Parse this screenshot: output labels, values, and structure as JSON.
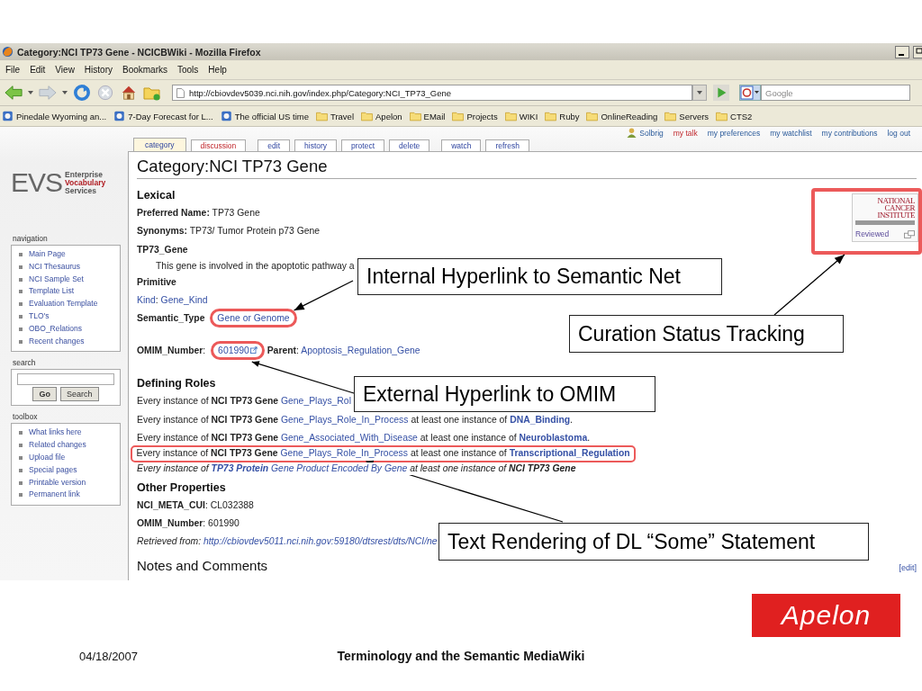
{
  "window": {
    "title": "Category:NCI TP73 Gene - NCICBWiki - Mozilla Firefox"
  },
  "menu": [
    "File",
    "Edit",
    "View",
    "History",
    "Bookmarks",
    "Tools",
    "Help"
  ],
  "toolbar": {
    "url": "http://cbiovdev5039.nci.nih.gov/index.php/Category:NCI_TP73_Gene",
    "search": {
      "placeholder": "Google"
    }
  },
  "bookmarks": [
    {
      "label": "Pinedale Wyoming an...",
      "kind": "page"
    },
    {
      "label": "7-Day Forecast for L...",
      "kind": "page"
    },
    {
      "label": "The official US time",
      "kind": "page"
    },
    {
      "label": "Travel",
      "kind": "folder"
    },
    {
      "label": "Apelon",
      "kind": "folder"
    },
    {
      "label": "EMail",
      "kind": "folder"
    },
    {
      "label": "Projects",
      "kind": "folder"
    },
    {
      "label": "WIKI",
      "kind": "folder"
    },
    {
      "label": "Ruby",
      "kind": "folder"
    },
    {
      "label": "OnlineReading",
      "kind": "folder"
    },
    {
      "label": "Servers",
      "kind": "folder"
    },
    {
      "label": "CTS2",
      "kind": "folder"
    }
  ],
  "personal": [
    {
      "label": "Solbrig",
      "kind": "user"
    },
    {
      "label": "my talk",
      "kind": "new"
    },
    {
      "label": "my preferences",
      "kind": "link"
    },
    {
      "label": "my watchlist",
      "kind": "link"
    },
    {
      "label": "my contributions",
      "kind": "link"
    },
    {
      "label": "log out",
      "kind": "link"
    }
  ],
  "tab_groups": [
    [
      {
        "label": "category",
        "selected": true,
        "exists": true
      },
      {
        "label": "discussion",
        "selected": false,
        "exists": false
      }
    ],
    [
      {
        "label": "edit",
        "selected": false,
        "exists": true
      },
      {
        "label": "history",
        "selected": false,
        "exists": true
      },
      {
        "label": "protect",
        "selected": false,
        "exists": true
      },
      {
        "label": "delete",
        "selected": false,
        "exists": true
      }
    ],
    [
      {
        "label": "watch",
        "selected": false,
        "exists": true
      },
      {
        "label": "refresh",
        "selected": false,
        "exists": true
      }
    ]
  ],
  "sidebar": {
    "logo": {
      "letters": "EVS",
      "lines": [
        {
          "text": "Enterprise",
          "color": "#555555"
        },
        {
          "text": "Vocabulary",
          "color": "#b01c22"
        },
        {
          "text": "Services",
          "color": "#555555"
        }
      ]
    },
    "navigation": {
      "title": "navigation",
      "items": [
        "Main Page",
        "NCI Thesaurus",
        "NCI Sample Set",
        "Template List",
        "Evaluation Template",
        "TLO's",
        "OBO_Relations",
        "Recent changes"
      ]
    },
    "search": {
      "title": "search",
      "buttons": [
        "Go",
        "Search"
      ]
    },
    "toolbox": {
      "title": "toolbox",
      "items": [
        "What links here",
        "Related changes",
        "Upload file",
        "Special pages",
        "Printable version",
        "Permanent link"
      ]
    }
  },
  "page": {
    "title": "Category:NCI TP73 Gene",
    "badge": {
      "lines": [
        "NATIONAL",
        "CANCER",
        "INSTITUTE"
      ],
      "caption": "Reviewed"
    },
    "blocks": [
      {
        "kind": "section",
        "text": "Lexical"
      },
      {
        "kind": "line",
        "segments": [
          {
            "kind": "label",
            "text": "Preferred Name:"
          },
          {
            "kind": "plain",
            "text": " TP73 Gene"
          }
        ]
      },
      {
        "kind": "line",
        "segments": [
          {
            "kind": "label",
            "text": "Synonyms:"
          },
          {
            "kind": "plain",
            "text": " TP73/ Tumor Protein p73 Gene"
          }
        ]
      },
      {
        "kind": "subhead",
        "text": "TP73_Gene"
      },
      {
        "kind": "indent",
        "segments": [
          {
            "kind": "plain",
            "text": "This gene is involved in the apoptotic pathway a"
          }
        ]
      },
      {
        "kind": "subhead",
        "text": "Primitive"
      },
      {
        "kind": "line",
        "segments": [
          {
            "kind": "link",
            "text": "Kind"
          },
          {
            "kind": "plain",
            "text": ": "
          },
          {
            "kind": "link",
            "text": "Gene_Kind"
          }
        ]
      },
      {
        "kind": "line",
        "segments": [
          {
            "kind": "label",
            "text": "Semantic_Type"
          },
          {
            "kind": "link",
            "text": "Gene or Genome"
          }
        ]
      },
      {
        "kind": "para",
        "segments": [
          {
            "kind": "label",
            "text": "OMIM_Number"
          },
          {
            "kind": "plain",
            "text": ": "
          },
          {
            "kind": "extlink",
            "text": "601990"
          },
          {
            "kind": "label",
            "text": "Parent"
          },
          {
            "kind": "plain",
            "text": ": "
          },
          {
            "kind": "link",
            "text": "Apoptosis_Regulation_Gene"
          }
        ]
      },
      {
        "kind": "section",
        "text": "Defining Roles"
      },
      {
        "kind": "role",
        "segments": [
          {
            "kind": "plain",
            "text": "Every instance of "
          },
          {
            "kind": "bold",
            "text": "NCI TP73 Gene"
          },
          {
            "kind": "link",
            "text": "Gene_Plays_Rol"
          }
        ]
      },
      {
        "kind": "role",
        "segments": [
          {
            "kind": "plain",
            "text": "Every instance of "
          },
          {
            "kind": "bold",
            "text": "NCI TP73 Gene"
          },
          {
            "kind": "link",
            "text": "Gene_Plays_Role_In_Process"
          },
          {
            "kind": "plain",
            "text": " at least one instance of "
          },
          {
            "kind": "boldlink",
            "text": "DNA_Binding"
          },
          {
            "kind": "plain",
            "text": "."
          }
        ]
      },
      {
        "kind": "role",
        "segments": [
          {
            "kind": "plain",
            "text": "Every instance of "
          },
          {
            "kind": "bold",
            "text": "NCI TP73 Gene"
          },
          {
            "kind": "link",
            "text": "Gene_Associated_With_Disease"
          },
          {
            "kind": "plain",
            "text": " at least one instance of "
          },
          {
            "kind": "boldlink",
            "text": "Neuroblastoma"
          },
          {
            "kind": "plain",
            "text": "."
          }
        ]
      },
      {
        "kind": "role",
        "segments": [
          {
            "kind": "plain",
            "text": "Every instance of "
          },
          {
            "kind": "bold",
            "text": "NCI TP73 Gene"
          },
          {
            "kind": "link",
            "text": "Gene_Plays_Role_In_Process"
          },
          {
            "kind": "plain",
            "text": " at least one instance of "
          },
          {
            "kind": "boldlink",
            "text": "Transcriptional_Regulation"
          }
        ]
      },
      {
        "kind": "italic-role",
        "segments": [
          {
            "kind": "plain",
            "text": "Every instance of "
          },
          {
            "kind": "boldlink",
            "text": "TP73 Protein"
          },
          {
            "kind": "link",
            "text": "Gene Product Encoded By Gene"
          },
          {
            "kind": "plain",
            "text": " at least one instance of "
          },
          {
            "kind": "bold",
            "text": "NCI TP73 Gene"
          }
        ]
      },
      {
        "kind": "section",
        "text": "Other Properties"
      },
      {
        "kind": "line",
        "segments": [
          {
            "kind": "label",
            "text": "NCI_META_CUI"
          },
          {
            "kind": "plain",
            "text": ": CL032388"
          }
        ]
      },
      {
        "kind": "line",
        "segments": [
          {
            "kind": "label",
            "text": "OMIM_Number"
          },
          {
            "kind": "plain",
            "text": ": 601990"
          }
        ]
      },
      {
        "kind": "retrieved",
        "segments": [
          {
            "kind": "plain",
            "text": "Retrieved from: "
          },
          {
            "kind": "link",
            "text": "http://cbiovdev5011.nci.nih.gov:59180/dtsrest/dts/NCI/ne"
          }
        ]
      },
      {
        "kind": "heading",
        "text": "Notes and Comments",
        "edit": "[edit]"
      }
    ]
  },
  "callouts": [
    {
      "text": "Internal Hyperlink to Semantic Net"
    },
    {
      "text": "Curation Status Tracking"
    },
    {
      "text": "External Hyperlink to OMIM"
    },
    {
      "text": "Text Rendering of DL “Some” Statement"
    }
  ],
  "slide": {
    "date": "04/18/2007",
    "title": "Terminology and the Semantic MediaWiki",
    "logo": "Apelon"
  }
}
